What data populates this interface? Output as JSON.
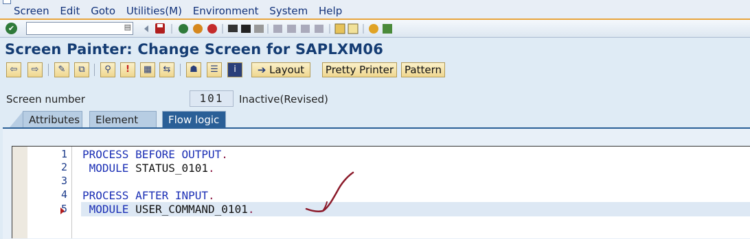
{
  "menubar": {
    "items": [
      "Screen",
      "Edit",
      "Goto",
      "Utilities(M)",
      "Environment",
      "System",
      "Help"
    ]
  },
  "system_toolbar": {
    "command_field_value": ""
  },
  "title": "Screen Painter: Change Screen for SAPLXM06",
  "app_toolbar": {
    "layout_label": "Layout",
    "pretty_printer_label": "Pretty Printer",
    "pattern_label": "Pattern"
  },
  "screen": {
    "number_label": "Screen number",
    "number_value": "101",
    "status": "Inactive(Revised)"
  },
  "tabs": [
    {
      "label": "Attributes",
      "active": false
    },
    {
      "label": "Element list",
      "active": false
    },
    {
      "label": "Flow logic",
      "active": true
    }
  ],
  "editor": {
    "line_numbers": [
      "1",
      "2",
      "3",
      "4",
      "5"
    ],
    "current_line": 5,
    "lines": [
      {
        "keyword": "PROCESS BEFORE OUTPUT",
        "ident": "",
        "end": "."
      },
      {
        "keyword": " MODULE",
        "ident": " STATUS_0101",
        "end": "."
      },
      {
        "keyword": "",
        "ident": "",
        "end": ""
      },
      {
        "keyword": "PROCESS AFTER INPUT",
        "ident": "",
        "end": "."
      },
      {
        "keyword": " MODULE",
        "ident": " USER_COMMAND_0101",
        "end": "."
      }
    ]
  },
  "colors": {
    "accent_orange": "#e8a33a",
    "title_blue": "#143c73",
    "active_tab": "#2a5f97",
    "keyword_blue": "#1b2fb5",
    "annotation_red": "#8b1a2a"
  }
}
